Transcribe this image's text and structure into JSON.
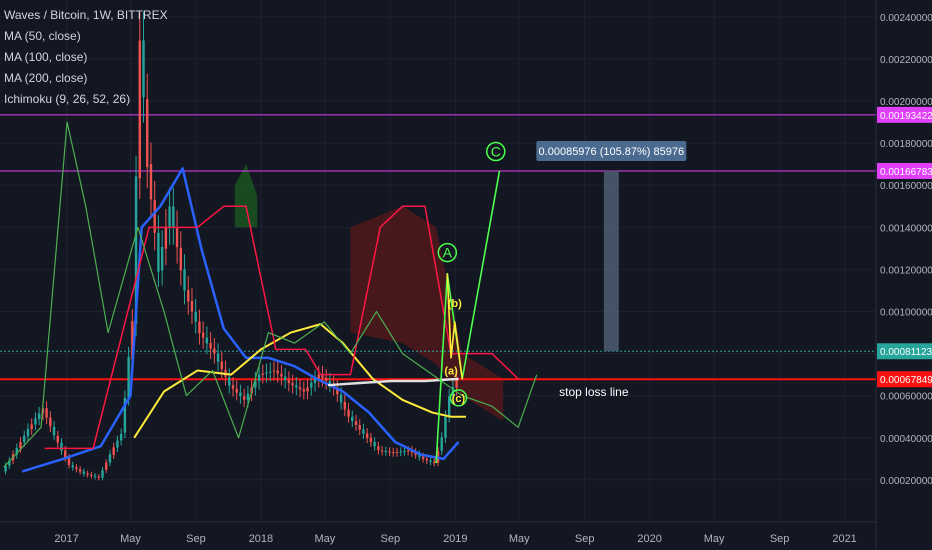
{
  "legend": {
    "title": "Waves / Bitcoin, 1W, BITTREX",
    "indicators": [
      "MA (50, close)",
      "MA (100, close)",
      "MA (200, close)",
      "Ichimoku (9, 26, 52, 26)"
    ]
  },
  "colors": {
    "background": "#131722",
    "grid": "#1e2230",
    "axis_text": "#b2b5be",
    "candle_up": "#26a69a",
    "candle_down": "#ef5350",
    "ma50": "#2962ff",
    "ma100": "#ffeb3b",
    "ma200": "#e0e0e0",
    "ichimoku_line": "#ff1744",
    "lagging_span": "#4caf50",
    "cloud_bull": "#1b5e20",
    "cloud_bear": "#5a1a1a",
    "magenta_level": "#e040fb",
    "stop_loss": "#ff1111",
    "current_price": "#26a69a",
    "wave_line": "#4cff4c",
    "wave_sub": "#ffeb3b",
    "measure_box": "#4a5a6e",
    "measure_label_bg": "#4a6a90"
  },
  "annotations": {
    "measure_label": "0.00085976 (105.87%) 85976",
    "stop_loss_label": "stop loss line",
    "wave_A": "A",
    "wave_C": "C",
    "wave_a": "(a)",
    "wave_b": "(b)",
    "wave_c": "(c)"
  },
  "chart_data": {
    "type": "candlestick",
    "title": "Waves / Bitcoin, 1W, BITTREX",
    "x_ticks": [
      "2017",
      "May",
      "Sep",
      "2018",
      "May",
      "Sep",
      "2019",
      "May",
      "Sep",
      "2020",
      "May",
      "Sep",
      "2021"
    ],
    "y_ticks": [
      "0.00020000",
      "0.00040000",
      "0.00060000",
      "0.00080000",
      "0.00100000",
      "0.00120000",
      "0.00140000",
      "0.00160000",
      "0.00180000",
      "0.00200000",
      "0.00220000",
      "0.00240000"
    ],
    "ylim": [
      0.0,
      0.00248
    ],
    "price_labels": [
      {
        "value": 0.00193422,
        "text": "0.00193422",
        "kind": "magenta"
      },
      {
        "value": 0.00166783,
        "text": "0.00166783",
        "kind": "magenta"
      },
      {
        "value": 0.00081123,
        "text": "0.00081123",
        "kind": "current"
      },
      {
        "value": 0.00067849,
        "text": "0.00067849",
        "kind": "stop"
      }
    ],
    "candles": [
      {
        "date": "2016-09-05",
        "close": 0.00024
      },
      {
        "date": "2016-09-26",
        "close": 0.00032
      },
      {
        "date": "2016-10-24",
        "close": 0.00044
      },
      {
        "date": "2016-11-21",
        "close": 0.00054
      },
      {
        "date": "2016-12-12",
        "close": 0.00041
      },
      {
        "date": "2017-01-09",
        "close": 0.00027
      },
      {
        "date": "2017-02-06",
        "close": 0.00023
      },
      {
        "date": "2017-03-06",
        "close": 0.00021
      },
      {
        "date": "2017-03-27",
        "close": 0.00032
      },
      {
        "date": "2017-04-17",
        "close": 0.00042
      },
      {
        "date": "2017-05-08",
        "close": 0.00095
      },
      {
        "date": "2017-05-22",
        "close": 0.0023
      },
      {
        "date": "2017-06-05",
        "close": 0.0017
      },
      {
        "date": "2017-06-26",
        "close": 0.0012
      },
      {
        "date": "2017-07-17",
        "close": 0.0015
      },
      {
        "date": "2017-08-14",
        "close": 0.0011
      },
      {
        "date": "2017-09-11",
        "close": 0.0009
      },
      {
        "date": "2017-10-09",
        "close": 0.0008
      },
      {
        "date": "2017-11-06",
        "close": 0.00065
      },
      {
        "date": "2017-12-04",
        "close": 0.00058
      },
      {
        "date": "2018-01-01",
        "close": 0.0007
      },
      {
        "date": "2018-01-29",
        "close": 0.00072
      },
      {
        "date": "2018-02-26",
        "close": 0.00066
      },
      {
        "date": "2018-03-26",
        "close": 0.00062
      },
      {
        "date": "2018-04-23",
        "close": 0.0007
      },
      {
        "date": "2018-05-21",
        "close": 0.00064
      },
      {
        "date": "2018-06-18",
        "close": 0.0005
      },
      {
        "date": "2018-07-16",
        "close": 0.00042
      },
      {
        "date": "2018-08-13",
        "close": 0.00034
      },
      {
        "date": "2018-09-10",
        "close": 0.00033
      },
      {
        "date": "2018-10-08",
        "close": 0.00034
      },
      {
        "date": "2018-11-05",
        "close": 0.0003
      },
      {
        "date": "2018-11-26",
        "close": 0.00028
      },
      {
        "date": "2018-12-10",
        "close": 0.0004
      },
      {
        "date": "2018-12-24",
        "close": 0.0006
      },
      {
        "date": "2019-01-07",
        "close": 0.00067849
      }
    ],
    "series": [
      {
        "name": "MA (50, close)",
        "color": "#2962ff",
        "points": [
          {
            "date": "2016-10-10",
            "value": 0.00024
          },
          {
            "date": "2016-12-26",
            "value": 0.0003
          },
          {
            "date": "2017-03-06",
            "value": 0.00036
          },
          {
            "date": "2017-05-01",
            "value": 0.0006
          },
          {
            "date": "2017-05-22",
            "value": 0.0014
          },
          {
            "date": "2017-06-26",
            "value": 0.0015
          },
          {
            "date": "2017-08-07",
            "value": 0.00168
          },
          {
            "date": "2017-09-11",
            "value": 0.0013
          },
          {
            "date": "2017-10-23",
            "value": 0.00092
          },
          {
            "date": "2017-12-04",
            "value": 0.00078
          },
          {
            "date": "2018-01-15",
            "value": 0.00078
          },
          {
            "date": "2018-03-05",
            "value": 0.00074
          },
          {
            "date": "2018-04-16",
            "value": 0.00068
          },
          {
            "date": "2018-06-04",
            "value": 0.00062
          },
          {
            "date": "2018-07-23",
            "value": 0.00052
          },
          {
            "date": "2018-09-10",
            "value": 0.00038
          },
          {
            "date": "2018-10-29",
            "value": 0.00032
          },
          {
            "date": "2018-12-10",
            "value": 0.0003
          },
          {
            "date": "2019-01-07",
            "value": 0.00038
          }
        ]
      },
      {
        "name": "MA (100, close)",
        "color": "#ffeb3b",
        "points": [
          {
            "date": "2017-05-08",
            "value": 0.0004
          },
          {
            "date": "2017-07-03",
            "value": 0.00062
          },
          {
            "date": "2017-09-04",
            "value": 0.00072
          },
          {
            "date": "2017-11-06",
            "value": 0.0007
          },
          {
            "date": "2018-01-01",
            "value": 0.00082
          },
          {
            "date": "2018-02-26",
            "value": 0.0009
          },
          {
            "date": "2018-04-23",
            "value": 0.00094
          },
          {
            "date": "2018-06-04",
            "value": 0.00085
          },
          {
            "date": "2018-07-30",
            "value": 0.00068
          },
          {
            "date": "2018-09-24",
            "value": 0.00058
          },
          {
            "date": "2018-11-19",
            "value": 0.00052
          },
          {
            "date": "2018-12-24",
            "value": 0.0005
          },
          {
            "date": "2019-01-21",
            "value": 0.0005
          }
        ]
      },
      {
        "name": "MA (200, close)",
        "color": "#e0e0e0",
        "points": [
          {
            "date": "2018-05-07",
            "value": 0.00065
          },
          {
            "date": "2018-07-02",
            "value": 0.00066
          },
          {
            "date": "2018-09-03",
            "value": 0.00067
          },
          {
            "date": "2018-11-05",
            "value": 0.00067
          },
          {
            "date": "2019-01-07",
            "value": 0.00068
          }
        ]
      },
      {
        "name": "Ichimoku span",
        "color": "#ff1744",
        "points": [
          {
            "date": "2016-11-21",
            "value": 0.00035
          },
          {
            "date": "2017-02-20",
            "value": 0.00035
          },
          {
            "date": "2017-06-05",
            "value": 0.0014
          },
          {
            "date": "2017-09-04",
            "value": 0.0014
          },
          {
            "date": "2017-10-23",
            "value": 0.0015
          },
          {
            "date": "2017-12-04",
            "value": 0.0015
          },
          {
            "date": "2018-01-29",
            "value": 0.00082
          },
          {
            "date": "2018-03-26",
            "value": 0.00082
          },
          {
            "date": "2018-04-23",
            "value": 0.0007
          },
          {
            "date": "2018-06-18",
            "value": 0.0007
          },
          {
            "date": "2018-08-13",
            "value": 0.0014
          },
          {
            "date": "2018-09-24",
            "value": 0.0015
          },
          {
            "date": "2018-11-05",
            "value": 0.0015
          },
          {
            "date": "2018-12-24",
            "value": 0.0008
          },
          {
            "date": "2019-03-11",
            "value": 0.0008
          },
          {
            "date": "2019-04-29",
            "value": 0.00068
          }
        ]
      },
      {
        "name": "Lagging span",
        "color": "#4caf50",
        "points": [
          {
            "date": "2016-09-05",
            "value": 0.00026
          },
          {
            "date": "2016-11-14",
            "value": 0.00045
          },
          {
            "date": "2017-01-02",
            "value": 0.0019
          },
          {
            "date": "2017-02-06",
            "value": 0.0015
          },
          {
            "date": "2017-03-20",
            "value": 0.0009
          },
          {
            "date": "2017-05-15",
            "value": 0.0014
          },
          {
            "date": "2017-07-03",
            "value": 0.001
          },
          {
            "date": "2017-08-14",
            "value": 0.0006
          },
          {
            "date": "2017-10-02",
            "value": 0.00072
          },
          {
            "date": "2017-11-20",
            "value": 0.0004
          },
          {
            "date": "2018-01-15",
            "value": 0.0009
          },
          {
            "date": "2018-03-05",
            "value": 0.00085
          },
          {
            "date": "2018-04-30",
            "value": 0.00095
          },
          {
            "date": "2018-06-18",
            "value": 0.0008
          },
          {
            "date": "2018-08-06",
            "value": 0.001
          },
          {
            "date": "2018-09-24",
            "value": 0.0008
          },
          {
            "date": "2018-11-19",
            "value": 0.0007
          },
          {
            "date": "2019-01-14",
            "value": 0.0006
          },
          {
            "date": "2019-03-11",
            "value": 0.00055
          },
          {
            "date": "2019-04-29",
            "value": 0.00045
          },
          {
            "date": "2019-06-03",
            "value": 0.0007
          }
        ]
      },
      {
        "name": "Wave path",
        "color": "#4cff4c",
        "points": [
          {
            "date": "2018-11-26",
            "value": 0.00028
          },
          {
            "date": "2018-12-17",
            "value": 0.00118
          },
          {
            "date": "2019-01-14",
            "value": 0.00068
          },
          {
            "date": "2019-03-25",
            "value": 0.00166783
          }
        ]
      },
      {
        "name": "Sub-wave path",
        "color": "#ffeb3b",
        "points": [
          {
            "date": "2018-12-17",
            "value": 0.00118
          },
          {
            "date": "2018-12-24",
            "value": 0.00078
          },
          {
            "date": "2018-12-31",
            "value": 0.00095
          },
          {
            "date": "2019-01-14",
            "value": 0.00068
          }
        ]
      }
    ],
    "cloud_bull": [
      {
        "date": "2017-11-13",
        "top": 0.0016,
        "bottom": 0.0014
      },
      {
        "date": "2017-12-04",
        "top": 0.0017,
        "bottom": 0.0014
      },
      {
        "date": "2017-12-25",
        "top": 0.00155,
        "bottom": 0.0014
      }
    ],
    "cloud_bear": [
      {
        "date": "2018-06-18",
        "top": 0.0014,
        "bottom": 0.0009
      },
      {
        "date": "2018-09-24",
        "top": 0.0015,
        "bottom": 0.00085
      },
      {
        "date": "2018-11-26",
        "top": 0.0014,
        "bottom": 0.00075
      },
      {
        "date": "2019-01-14",
        "top": 0.0008,
        "bottom": 0.0006
      },
      {
        "date": "2019-04-01",
        "top": 0.00068,
        "bottom": 0.00048
      }
    ],
    "horizontal_lines": [
      {
        "value": 0.00193422,
        "kind": "magenta"
      },
      {
        "value": 0.00166783,
        "kind": "magenta"
      },
      {
        "value": 0.00081123,
        "kind": "current"
      },
      {
        "value": 0.00067849,
        "kind": "stop"
      }
    ],
    "measure": {
      "start_date": "2019-10-07",
      "end_date": "2019-11-04",
      "low": 0.00081123,
      "high": 0.00166783
    },
    "wave_labels": [
      {
        "key": "wave_A",
        "date": "2018-12-17",
        "value": 0.00128,
        "style": "circle-green"
      },
      {
        "key": "wave_C",
        "date": "2019-03-18",
        "value": 0.00176,
        "style": "circle-green"
      },
      {
        "key": "wave_a",
        "date": "2018-12-24",
        "value": 0.00072,
        "style": "yellow"
      },
      {
        "key": "wave_b",
        "date": "2018-12-31",
        "value": 0.00104,
        "style": "yellow"
      },
      {
        "key": "wave_c",
        "date": "2019-01-07",
        "value": 0.00059,
        "style": "circle-yellow"
      }
    ]
  }
}
